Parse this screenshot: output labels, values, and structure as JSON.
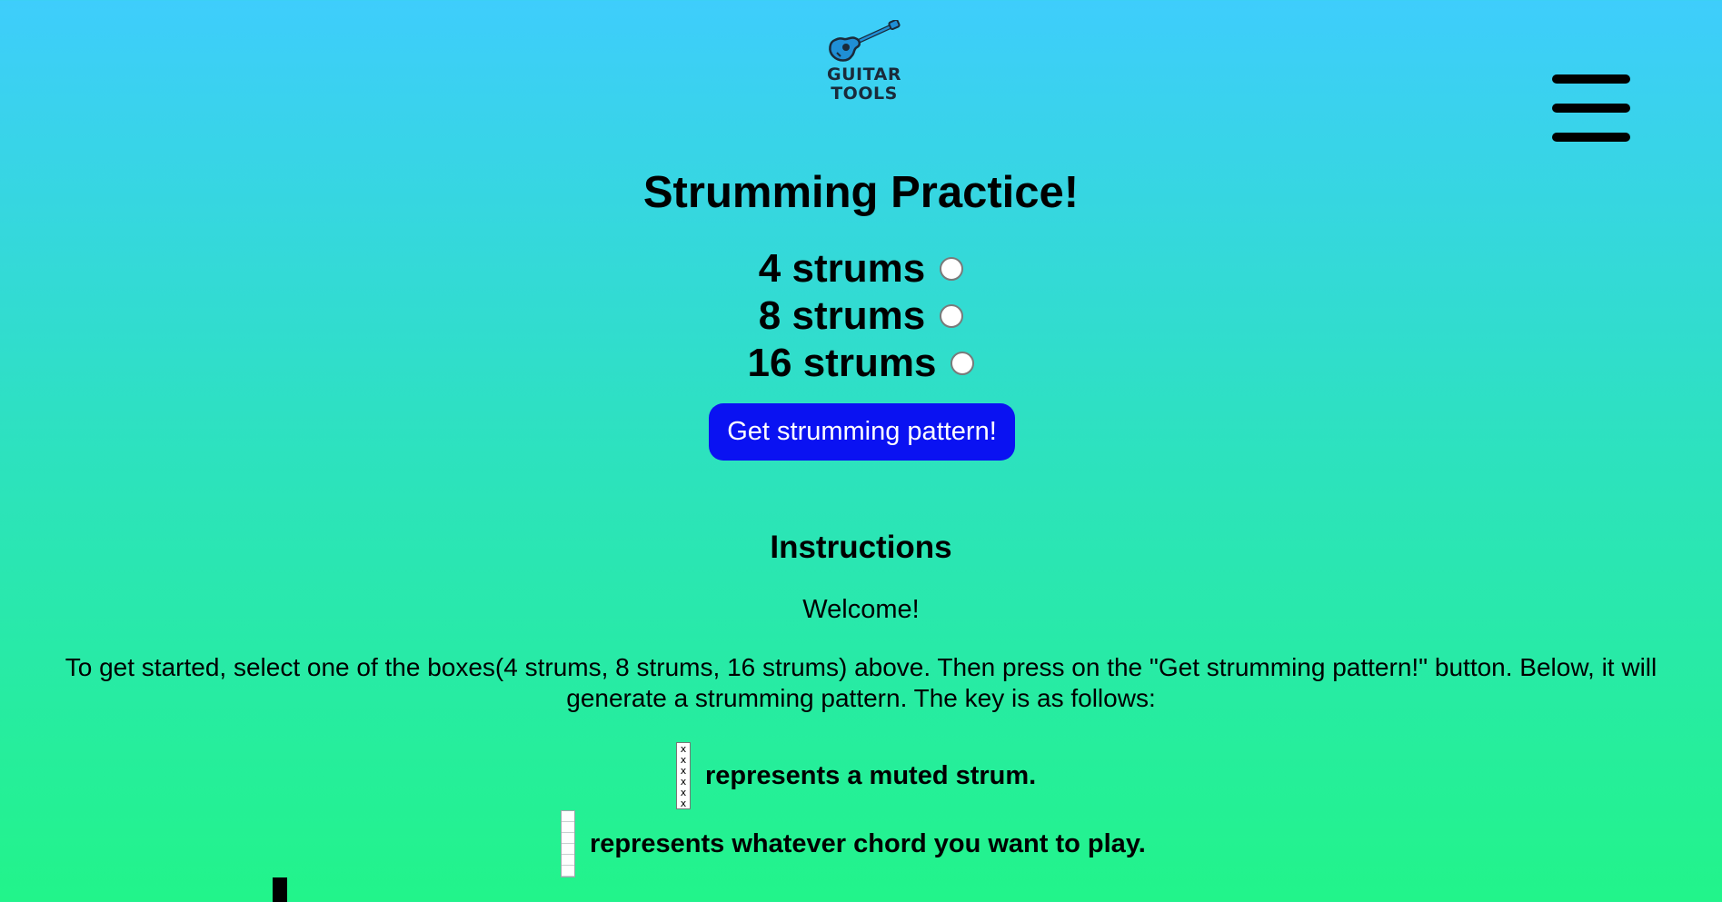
{
  "header": {
    "logo": {
      "icon": "guitar-icon",
      "line1": "GUITAR",
      "line2": "TOOLS"
    },
    "menu_icon": "hamburger-menu-icon"
  },
  "main": {
    "title": "Strumming Practice!",
    "options": [
      {
        "label": "4 strums",
        "selected": false
      },
      {
        "label": "8 strums",
        "selected": false
      },
      {
        "label": "16 strums",
        "selected": false
      }
    ],
    "button_label": "Get strumming pattern!",
    "button_color": "#0a12f2"
  },
  "instructions": {
    "title": "Instructions",
    "welcome": "Welcome!",
    "intro": "To get started, select one of the boxes(4 strums, 8 strums, 16 strums) above. Then press on the \"Get strumming pattern!\" button. Below, it will generate a strumming pattern. The key is as follows:",
    "key": [
      {
        "symbol": "muted-strum-box",
        "marks": [
          "x",
          "x",
          "x",
          "x",
          "x",
          "x"
        ],
        "text": "represents a muted strum."
      },
      {
        "symbol": "chord-box",
        "text": "represents whatever chord you want to play."
      },
      {
        "symbol": "black-box",
        "text": ""
      }
    ]
  },
  "colors": {
    "background_top": "#3ecdfc",
    "background_bottom": "#22f48a",
    "accent": "#0a12f2"
  }
}
